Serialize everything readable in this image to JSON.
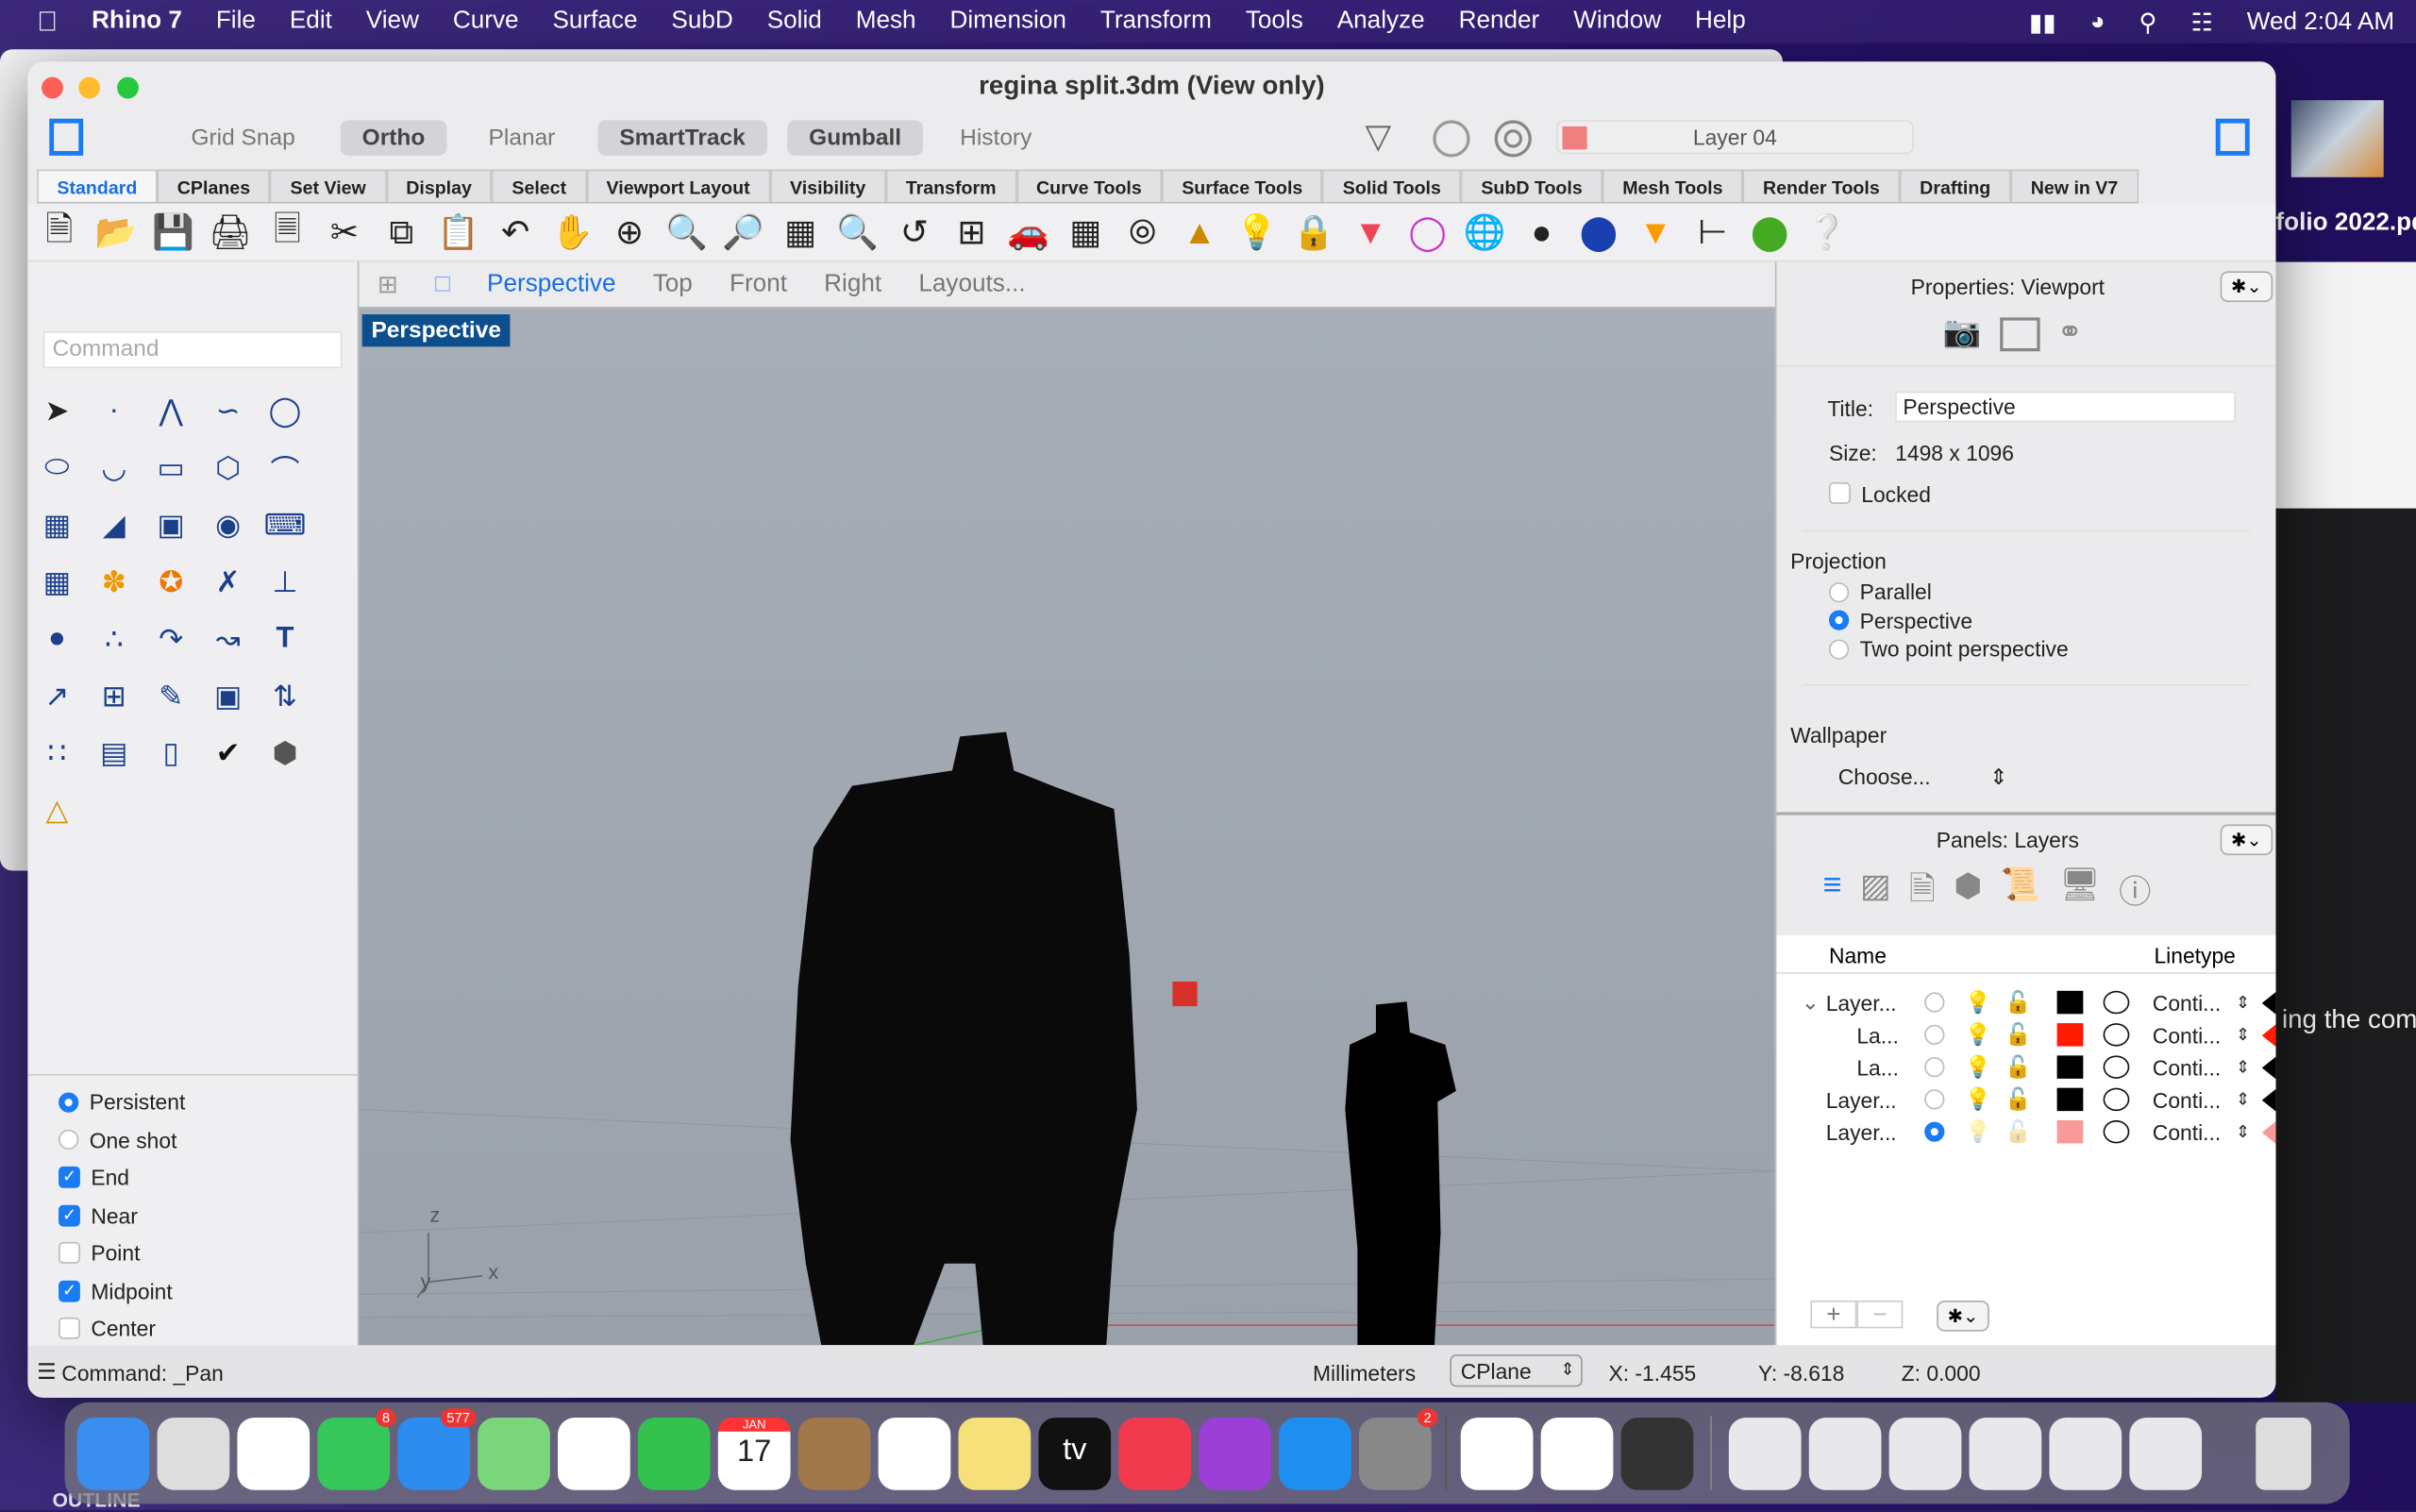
{
  "menubar": {
    "app": "Rhino 7",
    "items": [
      "File",
      "Edit",
      "View",
      "Curve",
      "Surface",
      "SubD",
      "Solid",
      "Mesh",
      "Dimension",
      "Transform",
      "Tools",
      "Analyze",
      "Render",
      "Window",
      "Help"
    ],
    "clock": "Wed  2:04 AM"
  },
  "window": {
    "title": "regina split.3dm (View only)",
    "toggles": [
      {
        "label": "Grid Snap",
        "on": false
      },
      {
        "label": "Ortho",
        "on": true
      },
      {
        "label": "Planar",
        "on": false
      },
      {
        "label": "SmartTrack",
        "on": true
      },
      {
        "label": "Gumball",
        "on": true
      },
      {
        "label": "History",
        "on": false
      }
    ],
    "current_layer": "Layer 04",
    "current_layer_color": "#f08080",
    "tabs": [
      "Standard",
      "CPlanes",
      "Set View",
      "Display",
      "Select",
      "Viewport Layout",
      "Visibility",
      "Transform",
      "Curve Tools",
      "Surface Tools",
      "Solid Tools",
      "SubD Tools",
      "Mesh Tools",
      "Render Tools",
      "Drafting",
      "New in V7"
    ],
    "active_tab": "Standard"
  },
  "command": {
    "placeholder": "Command"
  },
  "osnap": {
    "mode": [
      {
        "label": "Persistent",
        "on": true
      },
      {
        "label": "One shot",
        "on": false
      }
    ],
    "snaps": [
      {
        "label": "End",
        "on": true
      },
      {
        "label": "Near",
        "on": true
      },
      {
        "label": "Point",
        "on": false
      },
      {
        "label": "Midpoint",
        "on": true
      },
      {
        "label": "Center",
        "on": false
      }
    ]
  },
  "viewtabs": [
    "Perspective",
    "Top",
    "Front",
    "Right",
    "Layouts..."
  ],
  "viewport": {
    "label": "Perspective",
    "axes": {
      "z": "z",
      "y": "y",
      "x": "x"
    }
  },
  "properties": {
    "header": "Properties: Viewport",
    "title_label": "Title:",
    "title_value": "Perspective",
    "size_label": "Size:",
    "size_value": "1498 x 1096",
    "locked_label": "Locked",
    "projection_label": "Projection",
    "projection": [
      {
        "label": "Parallel",
        "on": false
      },
      {
        "label": "Perspective",
        "on": true
      },
      {
        "label": "Two point perspective",
        "on": false
      }
    ],
    "wallpaper_label": "Wallpaper",
    "wallpaper_value": "Choose..."
  },
  "layers": {
    "header": "Panels: Layers",
    "col_name": "Name",
    "col_linetype": "Linetype",
    "rows": [
      {
        "name": "Layer...",
        "indent": 0,
        "expand": true,
        "current": false,
        "color": "#000000",
        "linetype": "Conti...",
        "dim": false
      },
      {
        "name": "La...",
        "indent": 1,
        "current": false,
        "color": "#ff1a00",
        "linetype": "Conti...",
        "dim": false
      },
      {
        "name": "La...",
        "indent": 1,
        "current": false,
        "color": "#000000",
        "linetype": "Conti...",
        "dim": false
      },
      {
        "name": "Layer...",
        "indent": 0,
        "current": false,
        "color": "#000000",
        "linetype": "Conti...",
        "dim": false
      },
      {
        "name": "Layer...",
        "indent": 0,
        "current": true,
        "color": "#f89a98",
        "linetype": "Conti...",
        "dim": true
      }
    ]
  },
  "status": {
    "command": "Command: _Pan",
    "units": "Millimeters",
    "cplane": "CPlane",
    "x": "X: -1.455",
    "y": "Y: -8.618",
    "z": "Z: 0.000"
  },
  "desktop": {
    "file_label": "folio 2022.pd",
    "side_text": "ing the com",
    "outline": "OUTLINE"
  },
  "dock": {
    "apps": [
      {
        "name": "finder",
        "color": "#3a8ef0"
      },
      {
        "name": "launchpad",
        "color": "#ddd"
      },
      {
        "name": "safari",
        "color": "#fff"
      },
      {
        "name": "messages",
        "color": "#35c759",
        "badge": "8"
      },
      {
        "name": "mail",
        "color": "#2d8cf0",
        "badge": "577"
      },
      {
        "name": "maps",
        "color": "#7bd67b"
      },
      {
        "name": "photos",
        "color": "#fff"
      },
      {
        "name": "facetime",
        "color": "#32c24d"
      },
      {
        "name": "calendar",
        "color": "#fff",
        "text": "17",
        "month": "JAN"
      },
      {
        "name": "contacts",
        "color": "#a0784a"
      },
      {
        "name": "reminders",
        "color": "#fff"
      },
      {
        "name": "notes",
        "color": "#f6e07a"
      },
      {
        "name": "appletv",
        "color": "#111",
        "text": "tv"
      },
      {
        "name": "music",
        "color": "#f23a4f"
      },
      {
        "name": "podcasts",
        "color": "#9b3fd6"
      },
      {
        "name": "appstore",
        "color": "#1e8ff0"
      },
      {
        "name": "system-preferences",
        "color": "#888",
        "badge": "2"
      },
      {
        "name": "chrome",
        "color": "#fff"
      },
      {
        "name": "powerpoint",
        "color": "#fff"
      },
      {
        "name": "rhino",
        "color": "#333"
      }
    ]
  }
}
